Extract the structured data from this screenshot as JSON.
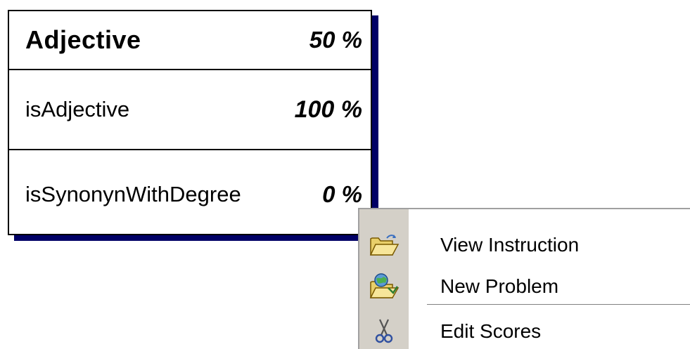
{
  "score_card": {
    "rows": [
      {
        "label": "Adjective",
        "value": "50 %"
      },
      {
        "label": "isAdjective",
        "value": "100 %"
      },
      {
        "label": "isSynonynWithDegree",
        "value": "0 %"
      }
    ],
    "shadow_color": "#000066"
  },
  "context_menu": {
    "items": [
      {
        "icon": "open-folder-icon",
        "label": "View Instruction"
      },
      {
        "icon": "folder-globe-icon",
        "label": "New Problem"
      },
      {
        "icon": "scissors-icon",
        "label": "Edit Scores"
      }
    ],
    "gutter_color": "#d4d0c8"
  }
}
